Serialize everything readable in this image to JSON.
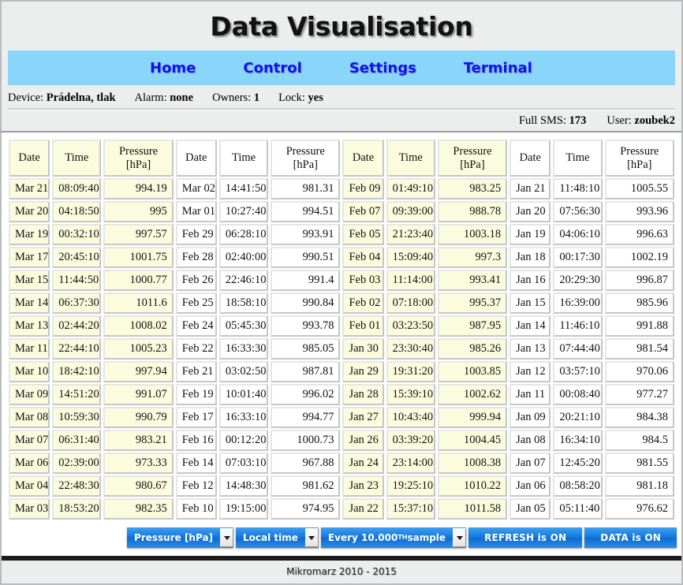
{
  "header": {
    "title": "Data Visualisation"
  },
  "nav": {
    "items": [
      {
        "label": "Home"
      },
      {
        "label": "Control"
      },
      {
        "label": "Settings"
      },
      {
        "label": "Terminal"
      }
    ]
  },
  "device_info": {
    "device_label": "Device:",
    "device_value": "Prádelna, tlak",
    "alarm_label": "Alarm:",
    "alarm_value": "none",
    "owners_label": "Owners:",
    "owners_value": "1",
    "lock_label": "Lock:",
    "lock_value": "yes"
  },
  "status_bar": {
    "sms_label": "Full SMS:",
    "sms_value": "173",
    "user_label": "User:",
    "user_value": "zoubek2"
  },
  "table": {
    "headers": {
      "date": "Date",
      "time": "Time",
      "pressure_line1": "Pressure",
      "pressure_line2": "[hPa]"
    },
    "groups": [
      {
        "tinted": true,
        "rows": [
          {
            "date": "Mar 21",
            "time": "08:09:40",
            "pressure": "994.19"
          },
          {
            "date": "Mar 20",
            "time": "04:18:50",
            "pressure": "995"
          },
          {
            "date": "Mar 19",
            "time": "00:32:10",
            "pressure": "997.57"
          },
          {
            "date": "Mar 17",
            "time": "20:45:10",
            "pressure": "1001.75"
          },
          {
            "date": "Mar 15",
            "time": "11:44:50",
            "pressure": "1000.77"
          },
          {
            "date": "Mar 14",
            "time": "06:37:30",
            "pressure": "1011.6"
          },
          {
            "date": "Mar 13",
            "time": "02:44:20",
            "pressure": "1008.02"
          },
          {
            "date": "Mar 11",
            "time": "22:44:10",
            "pressure": "1005.23"
          },
          {
            "date": "Mar 10",
            "time": "18:42:10",
            "pressure": "997.94"
          },
          {
            "date": "Mar 09",
            "time": "14:51:20",
            "pressure": "991.07"
          },
          {
            "date": "Mar 08",
            "time": "10:59:30",
            "pressure": "990.79"
          },
          {
            "date": "Mar 07",
            "time": "06:31:40",
            "pressure": "983.21"
          },
          {
            "date": "Mar 06",
            "time": "02:39:00",
            "pressure": "973.33"
          },
          {
            "date": "Mar 04",
            "time": "22:48:30",
            "pressure": "980.67"
          },
          {
            "date": "Mar 03",
            "time": "18:53:20",
            "pressure": "982.35"
          }
        ]
      },
      {
        "tinted": false,
        "rows": [
          {
            "date": "Mar 02",
            "time": "14:41:50",
            "pressure": "981.31"
          },
          {
            "date": "Mar 01",
            "time": "10:27:40",
            "pressure": "994.51"
          },
          {
            "date": "Feb 29",
            "time": "06:28:10",
            "pressure": "993.91"
          },
          {
            "date": "Feb 28",
            "time": "02:40:00",
            "pressure": "990.51"
          },
          {
            "date": "Feb 26",
            "time": "22:46:10",
            "pressure": "991.4"
          },
          {
            "date": "Feb 25",
            "time": "18:58:10",
            "pressure": "990.84"
          },
          {
            "date": "Feb 24",
            "time": "05:45:30",
            "pressure": "993.78"
          },
          {
            "date": "Feb 22",
            "time": "16:33:30",
            "pressure": "985.05"
          },
          {
            "date": "Feb 21",
            "time": "03:02:50",
            "pressure": "987.81"
          },
          {
            "date": "Feb 19",
            "time": "10:01:40",
            "pressure": "996.02"
          },
          {
            "date": "Feb 17",
            "time": "16:33:10",
            "pressure": "994.77"
          },
          {
            "date": "Feb 16",
            "time": "00:12:20",
            "pressure": "1000.73"
          },
          {
            "date": "Feb 14",
            "time": "07:03:10",
            "pressure": "967.88"
          },
          {
            "date": "Feb 12",
            "time": "14:48:30",
            "pressure": "981.62"
          },
          {
            "date": "Feb 10",
            "time": "19:15:00",
            "pressure": "974.95"
          }
        ]
      },
      {
        "tinted": true,
        "rows": [
          {
            "date": "Feb 09",
            "time": "01:49:10",
            "pressure": "983.25"
          },
          {
            "date": "Feb 07",
            "time": "09:39:00",
            "pressure": "988.78"
          },
          {
            "date": "Feb 05",
            "time": "21:23:40",
            "pressure": "1003.18"
          },
          {
            "date": "Feb 04",
            "time": "15:09:40",
            "pressure": "997.3"
          },
          {
            "date": "Feb 03",
            "time": "11:14:00",
            "pressure": "993.41"
          },
          {
            "date": "Feb 02",
            "time": "07:18:00",
            "pressure": "995.37"
          },
          {
            "date": "Feb 01",
            "time": "03:23:50",
            "pressure": "987.95"
          },
          {
            "date": "Jan 30",
            "time": "23:30:40",
            "pressure": "985.26"
          },
          {
            "date": "Jan 29",
            "time": "19:31:20",
            "pressure": "1003.85"
          },
          {
            "date": "Jan 28",
            "time": "15:39:10",
            "pressure": "1002.62"
          },
          {
            "date": "Jan 27",
            "time": "10:43:40",
            "pressure": "999.94"
          },
          {
            "date": "Jan 26",
            "time": "03:39:20",
            "pressure": "1004.45"
          },
          {
            "date": "Jan 24",
            "time": "23:14:00",
            "pressure": "1008.38"
          },
          {
            "date": "Jan 23",
            "time": "19:25:10",
            "pressure": "1010.22"
          },
          {
            "date": "Jan 22",
            "time": "15:37:10",
            "pressure": "1011.58"
          }
        ]
      },
      {
        "tinted": false,
        "rows": [
          {
            "date": "Jan 21",
            "time": "11:48:10",
            "pressure": "1005.55"
          },
          {
            "date": "Jan 20",
            "time": "07:56:30",
            "pressure": "993.96"
          },
          {
            "date": "Jan 19",
            "time": "04:06:10",
            "pressure": "996.63"
          },
          {
            "date": "Jan 18",
            "time": "00:17:30",
            "pressure": "1002.19"
          },
          {
            "date": "Jan 16",
            "time": "20:29:30",
            "pressure": "996.87"
          },
          {
            "date": "Jan 15",
            "time": "16:39:00",
            "pressure": "985.96"
          },
          {
            "date": "Jan 14",
            "time": "11:46:10",
            "pressure": "991.88"
          },
          {
            "date": "Jan 13",
            "time": "07:44:40",
            "pressure": "981.54"
          },
          {
            "date": "Jan 12",
            "time": "03:57:10",
            "pressure": "970.06"
          },
          {
            "date": "Jan 11",
            "time": "00:08:40",
            "pressure": "977.27"
          },
          {
            "date": "Jan 09",
            "time": "20:21:10",
            "pressure": "984.38"
          },
          {
            "date": "Jan 08",
            "time": "16:34:10",
            "pressure": "984.5"
          },
          {
            "date": "Jan 07",
            "time": "12:45:20",
            "pressure": "981.55"
          },
          {
            "date": "Jan 06",
            "time": "08:58:20",
            "pressure": "981.18"
          },
          {
            "date": "Jan 05",
            "time": "05:11:40",
            "pressure": "976.62"
          }
        ]
      }
    ]
  },
  "toolbar": {
    "quantity_select": "Pressure [hPa]",
    "timebase_select": "Local time",
    "sampling_select_prefix": "Every 10.000",
    "sampling_select_ordinal": "TH",
    "sampling_select_suffix": " sample",
    "refresh_button": "REFRESH is ON",
    "data_button": "DATA is ON"
  },
  "footer": {
    "copyright": "Mikromarz 2010 - 2015"
  },
  "colors": {
    "nav_bg": "#8ad6fb",
    "nav_link": "#1111ee",
    "chrome_bg": "#eceded",
    "cell_tint": "#fbfbdd",
    "button_blue": "#1278dc"
  }
}
